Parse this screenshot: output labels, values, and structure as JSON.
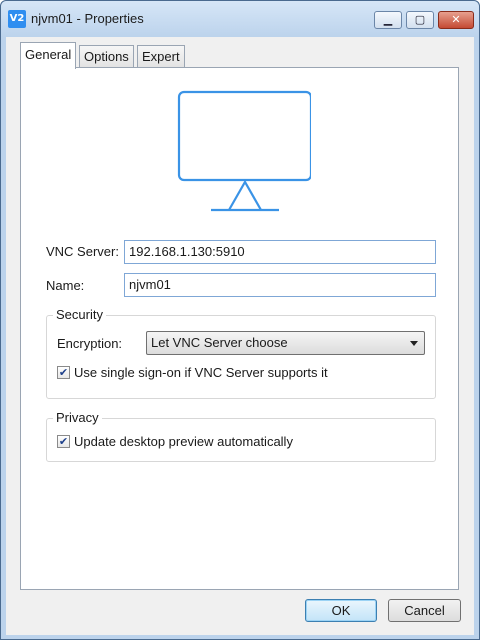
{
  "window": {
    "title": "njvm01 - Properties",
    "app_icon_text": "V2",
    "controls": {
      "minimize": "▁",
      "maximize": "▢",
      "close": "✕"
    }
  },
  "tabs": [
    {
      "label": "General",
      "active": true
    },
    {
      "label": "Options",
      "active": false
    },
    {
      "label": "Expert",
      "active": false
    }
  ],
  "general": {
    "preview_icon": "monitor-icon",
    "vnc_server_label": "VNC Server:",
    "vnc_server_value": "192.168.1.130:5910",
    "name_label": "Name:",
    "name_value": "njvm01",
    "security": {
      "title": "Security",
      "encryption_label": "Encryption:",
      "encryption_value": "Let VNC Server choose",
      "sso_checked": true,
      "sso_label": "Use single sign-on if VNC Server supports it"
    },
    "privacy": {
      "title": "Privacy",
      "preview_checked": true,
      "preview_label": "Update desktop preview automatically"
    }
  },
  "buttons": {
    "ok": "OK",
    "cancel": "Cancel"
  },
  "colors": {
    "accent": "#2f8ef0",
    "monitor": "#3a93e6",
    "field_border": "#7fa7d6"
  }
}
